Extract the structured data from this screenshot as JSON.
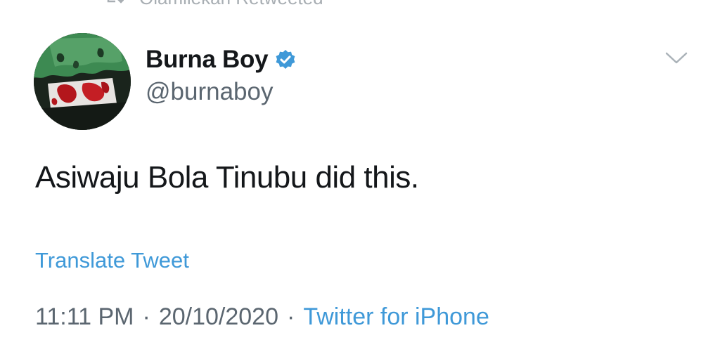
{
  "retweet_context": {
    "text": "Olamilekan Retweeted",
    "icon": "retweet-icon"
  },
  "author": {
    "display_name": "Burna Boy",
    "handle": "@burnaboy",
    "verified": true,
    "verified_icon": "verified-badge-icon",
    "verified_color": "#3f99d8"
  },
  "menu_icon": "chevron-down-icon",
  "tweet": {
    "text": "Asiwaju Bola Tinubu did this.",
    "translate_label": "Translate Tweet",
    "time": "11:11 PM",
    "separator": "·",
    "date": "20/10/2020",
    "source": "Twitter for iPhone"
  },
  "colors": {
    "link": "#3f99d8",
    "text_primary": "#14171a",
    "text_secondary": "#5b6670"
  }
}
